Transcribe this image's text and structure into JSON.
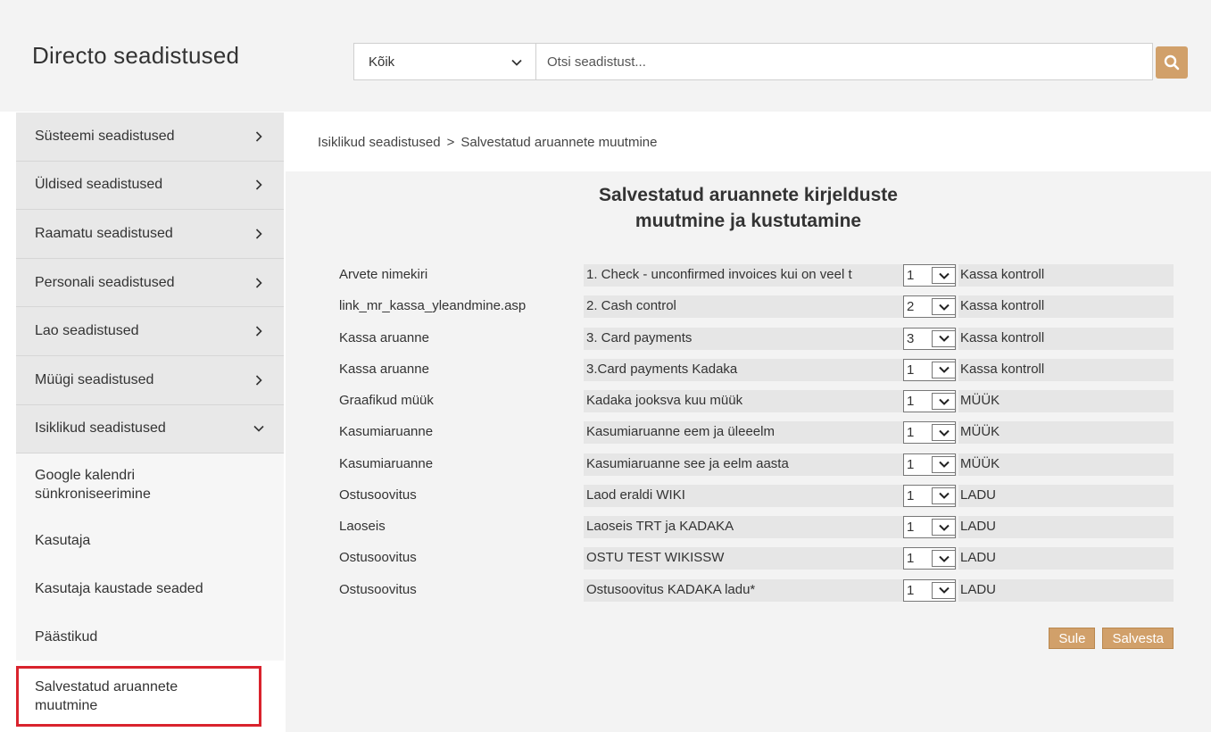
{
  "header": {
    "brand": "Directo seadistused",
    "scope_value": "Kõik",
    "search_placeholder": "Otsi seadistust..."
  },
  "sidebar": {
    "sections": [
      {
        "label": "Süsteemi seadistused"
      },
      {
        "label": "Üldised seadistused"
      },
      {
        "label": "Raamatu seadistused"
      },
      {
        "label": "Personali seadistused"
      },
      {
        "label": "Lao seadistused"
      },
      {
        "label": "Müügi seadistused"
      },
      {
        "label": "Isiklikud seadistused"
      }
    ],
    "sub_items": [
      {
        "label": "Google kalendri sünkroniseerimine"
      },
      {
        "label": "Kasutaja"
      },
      {
        "label": "Kasutaja kaustade seaded"
      },
      {
        "label": "Päästikud"
      },
      {
        "label": "Salvestatud aruannete muutmine"
      }
    ]
  },
  "breadcrumb": {
    "parent": "Isiklikud seadistused",
    "separator": ">",
    "current": "Salvestatud aruannete muutmine"
  },
  "page": {
    "title_line1": "Salvestatud aruannete kirjelduste",
    "title_line2": "muutmine ja kustutamine"
  },
  "reports": [
    {
      "report": "Arvete nimekiri",
      "name": "1. Check - unconfirmed invoices kui on veel t",
      "order": "1",
      "group": "Kassa kontroll"
    },
    {
      "report": "link_mr_kassa_yleandmine.asp",
      "name": "2. Cash control",
      "order": "2",
      "group": "Kassa kontroll"
    },
    {
      "report": "Kassa aruanne",
      "name": "3. Card payments",
      "order": "3",
      "group": "Kassa kontroll"
    },
    {
      "report": "Kassa aruanne",
      "name": "3.Card payments Kadaka",
      "order": "1",
      "group": "Kassa kontroll"
    },
    {
      "report": "Graafikud müük",
      "name": "Kadaka jooksva kuu müük",
      "order": "1",
      "group": "MÜÜK"
    },
    {
      "report": "Kasumiaruanne",
      "name": "Kasumiaruanne eem ja üleeelm",
      "order": "1",
      "group": "MÜÜK"
    },
    {
      "report": "Kasumiaruanne",
      "name": "Kasumiaruanne see ja eelm aasta",
      "order": "1",
      "group": "MÜÜK"
    },
    {
      "report": "Ostusoovitus",
      "name": "Laod eraldi WIKI",
      "order": "1",
      "group": "LADU"
    },
    {
      "report": "Laoseis",
      "name": "Laoseis TRT ja KADAKA",
      "order": "1",
      "group": "LADU"
    },
    {
      "report": "Ostusoovitus",
      "name": "OSTU TEST WIKISSW",
      "order": "1",
      "group": "LADU"
    },
    {
      "report": "Ostusoovitus",
      "name": "Ostusoovitus KADAKA ladu*",
      "order": "1",
      "group": "LADU"
    }
  ],
  "buttons": {
    "close": "Sule",
    "save": "Salvesta"
  },
  "colors": {
    "accent": "#d1a06a",
    "active_border": "#d9232d"
  }
}
